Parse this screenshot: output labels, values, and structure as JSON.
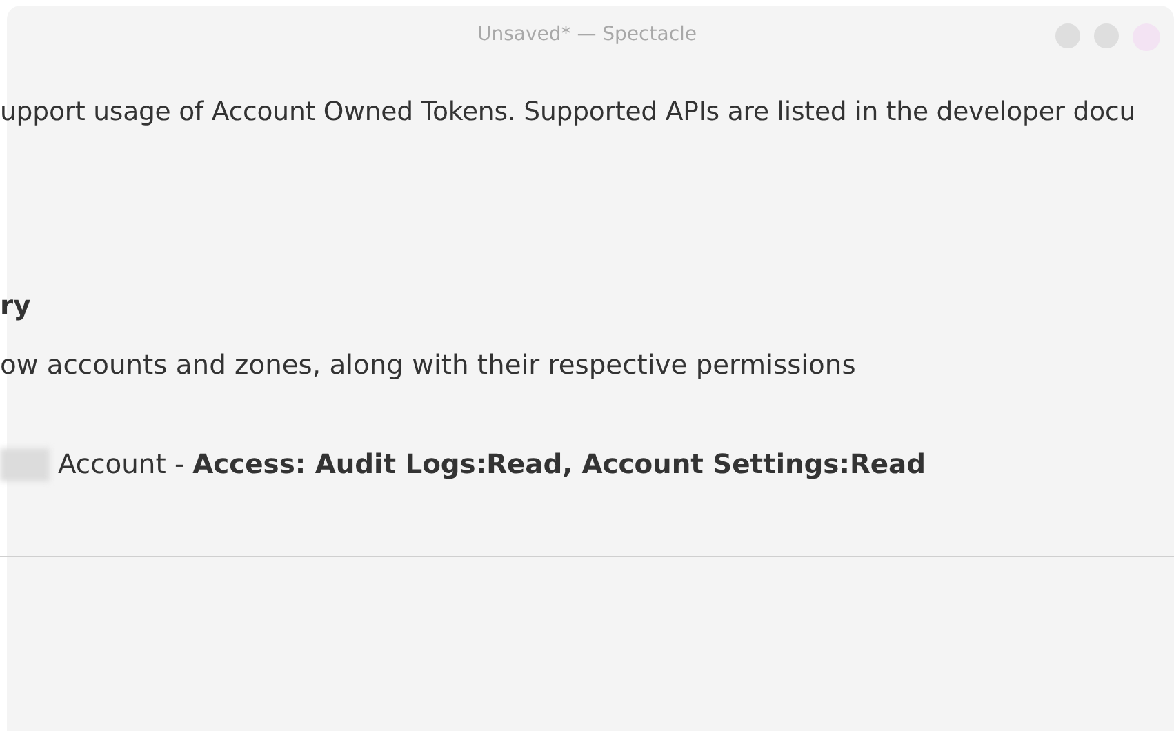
{
  "window": {
    "title": "Unsaved* — Spectacle"
  },
  "content": {
    "notice": "upport usage of Account Owned Tokens. Supported APIs are listed in the developer docu",
    "heading": "ry",
    "description": "ow accounts and zones, along with their respective permissions",
    "permission": "Account - **Access: Audit Logs:Read, Account Settings:Read**"
  }
}
